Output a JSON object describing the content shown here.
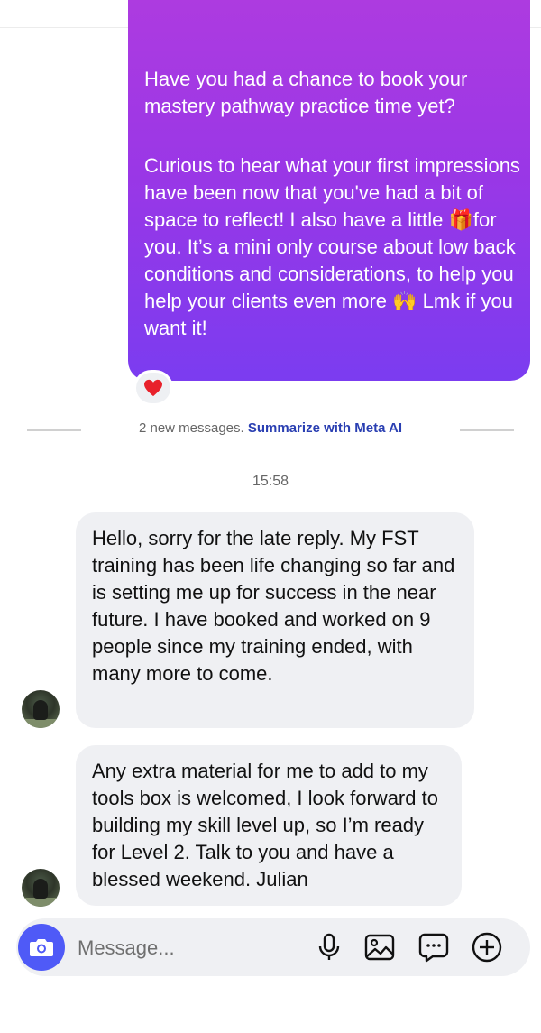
{
  "sent_message": {
    "paragraph1": "Have you had a chance to book your mastery pathway practice time yet?",
    "paragraph2_a": "Curious to hear what your first impressions have been now that you've had a bit of space to reflect! I also have a little ",
    "paragraph2_emoji": "🎁",
    "paragraph2_b": "for you. It’s a mini only course about low back conditions and considerations, to help you help your clients even more ",
    "paragraph2_emoji2": "🙌",
    "paragraph2_c": " Lmk if you want it!",
    "reaction": "❤️"
  },
  "divider": {
    "new_messages": "2 new messages.",
    "summarize_link": "Summarize with Meta AI"
  },
  "timestamp": "15:58",
  "received_messages": [
    {
      "text": "Hello, sorry for the late reply. My FST training has been life changing so far and is setting me up for success in the near future.  I have booked and worked on 9 people since my training ended, with many more to come."
    },
    {
      "text": "Any extra material for me to add to my tools box is welcomed, I look forward to building my skill level up, so I’m ready for Level 2. Talk to you and have a blessed weekend. Julian"
    }
  ],
  "composer": {
    "placeholder": "Message...",
    "icons": [
      "camera-icon",
      "microphone-icon",
      "image-icon",
      "sticker-icon",
      "plus-icon"
    ],
    "accent": "#4f5af7"
  },
  "colors": {
    "sent_gradient_top": "#ad3be0",
    "sent_gradient_bottom": "#7b3cf0",
    "received_bubble": "#eff0f3",
    "link": "#2a3fb2"
  }
}
